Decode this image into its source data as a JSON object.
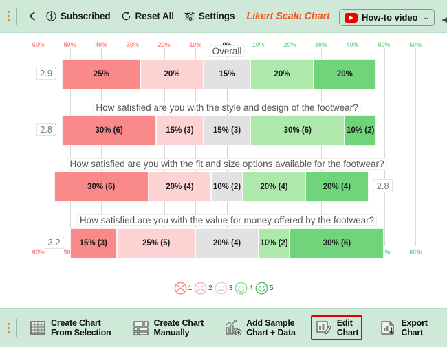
{
  "topbar": {
    "grip": "drag-grip",
    "back_label": "←",
    "items": [
      {
        "id": "subscribed",
        "label": "Subscribed",
        "icon": "dollar-circle-icon"
      },
      {
        "id": "reset-all",
        "label": "Reset All",
        "icon": "reset-icon"
      },
      {
        "id": "settings",
        "label": "Settings",
        "icon": "sliders-icon"
      }
    ],
    "chart_title": "Likert Scale Chart",
    "howto": {
      "label": "How-to video",
      "icon": "youtube-icon",
      "chevron": "⌄"
    },
    "edge_arrow": "◀"
  },
  "chart_data": {
    "type": "bar",
    "subtype": "diverging-stacked-likert",
    "title": "Likert Scale Chart",
    "xlabel": "",
    "ylabel": "",
    "xlim": [
      -60,
      60
    ],
    "xticks": [
      "60%",
      "50%",
      "40%",
      "30%",
      "20%",
      "10%",
      "0%",
      "10%",
      "20%",
      "30%",
      "40%",
      "50%",
      "60%"
    ],
    "xtick_values": [
      -60,
      -50,
      -40,
      -30,
      -20,
      -10,
      0,
      10,
      20,
      30,
      40,
      50,
      60
    ],
    "grid": true,
    "legend_position": "bottom",
    "tick_color_negative": "#f98a8a",
    "tick_color_positive": "#7fd48f",
    "tick_color_zero": "#333333",
    "categories": [
      "Overall",
      "How satisfied are you with the style and design of the footwear?",
      "How satisfied are you with the fit and size options available for the footwear?",
      "How satisfied are you with the value for money offered by the footwear?"
    ],
    "scores": [
      "2.9",
      "2.8",
      "2.8",
      "3.2"
    ],
    "score_side": [
      "left",
      "left",
      "right",
      "left"
    ],
    "series": [
      {
        "name": "1",
        "color": "#fa8a8a",
        "values": [
          25,
          30,
          30,
          15
        ],
        "labels": [
          "25%",
          "30% (6)",
          "30% (6)",
          "15% (3)"
        ]
      },
      {
        "name": "2",
        "color": "#fcd2d2",
        "values": [
          20,
          15,
          20,
          25
        ],
        "labels": [
          "20%",
          "15% (3)",
          "20% (4)",
          "25% (5)"
        ]
      },
      {
        "name": "3",
        "color": "#e2e2e2",
        "values": [
          15,
          15,
          10,
          20
        ],
        "labels": [
          "15%",
          "15% (3)",
          "10% (2)",
          "20% (4)"
        ]
      },
      {
        "name": "4",
        "color": "#aee8ab",
        "values": [
          20,
          30,
          20,
          10
        ],
        "labels": [
          "20%",
          "30% (6)",
          "20% (4)",
          "10% (2)"
        ]
      },
      {
        "name": "5",
        "color": "#6fd47a",
        "values": [
          20,
          10,
          20,
          30
        ],
        "labels": [
          "20%",
          "10% (2)",
          "20% (4)",
          "30% (6)"
        ]
      }
    ],
    "legend": [
      {
        "num": "1",
        "face": "very-sad-face-icon",
        "color": "#fa8a8a"
      },
      {
        "num": "2",
        "face": "sad-face-icon",
        "color": "#f7b6b6"
      },
      {
        "num": "3",
        "face": "neutral-face-icon",
        "color": "#d9d9d9"
      },
      {
        "num": "4",
        "face": "happy-face-icon",
        "color": "#8fdc8c"
      },
      {
        "num": "5",
        "face": "very-happy-face-icon",
        "color": "#4fc95e"
      }
    ]
  },
  "bottombar": {
    "grip": "drag-grip",
    "items": [
      {
        "id": "create-chart-from-selection",
        "line1": "Create Chart",
        "line2": "From Selection",
        "icon": "table-grid-icon",
        "selected": false
      },
      {
        "id": "create-chart-manually",
        "line1": "Create Chart",
        "line2": "Manually",
        "icon": "form-layout-icon",
        "selected": false
      },
      {
        "id": "add-sample-chart-data",
        "line1": "Add Sample",
        "line2": "Chart + Data",
        "icon": "chart-plus-icon",
        "selected": false
      },
      {
        "id": "edit-chart",
        "line1": "Edit",
        "line2": "Chart",
        "icon": "chart-pencil-icon",
        "selected": true
      },
      {
        "id": "export-chart",
        "line1": "Export",
        "line2": "Chart",
        "icon": "chart-download-icon",
        "selected": false
      }
    ]
  },
  "colors": {
    "toolbar_bg": "#cfe9d8",
    "accent_orange": "#f4541d",
    "selection_red": "#e60000",
    "youtube_red": "#f20000"
  }
}
